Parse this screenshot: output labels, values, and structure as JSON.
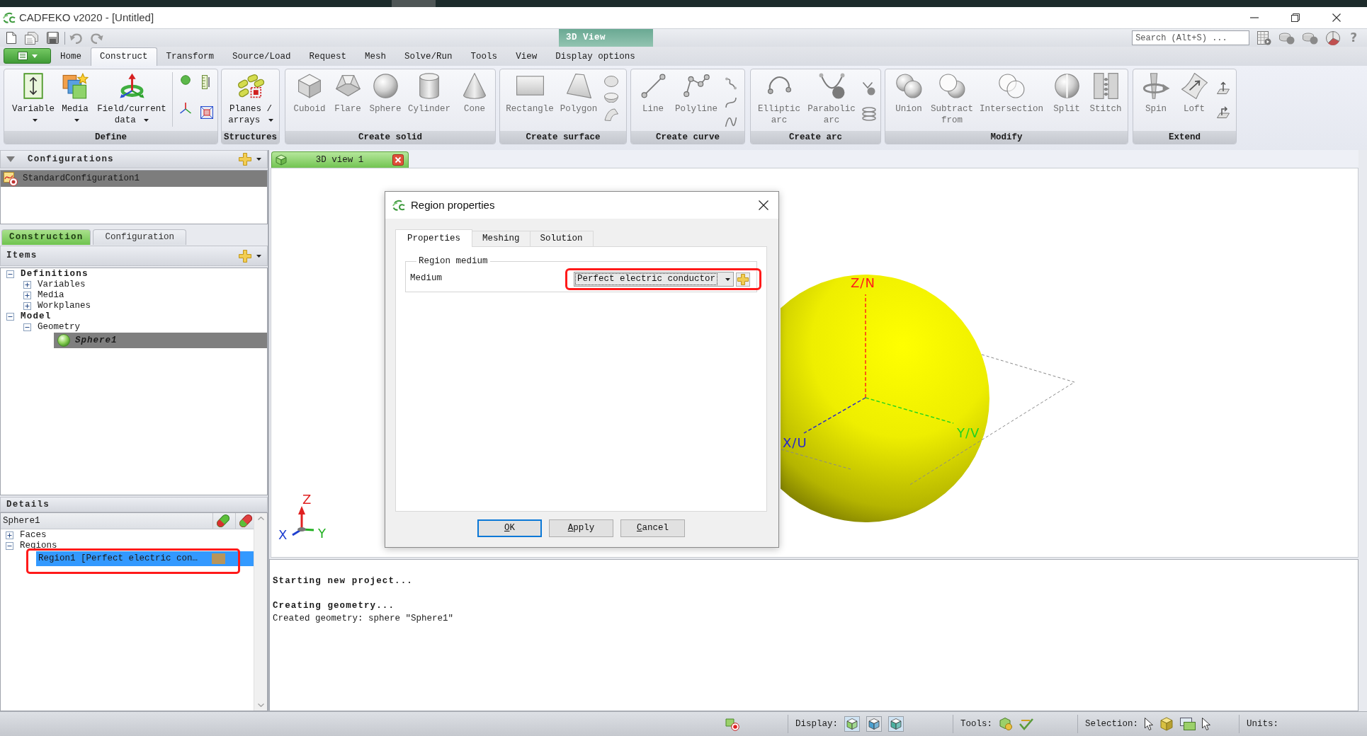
{
  "window": {
    "title": "CADFEKO v2020 - [Untitled]"
  },
  "quick_access": {
    "context_tab": "3D View",
    "search": {
      "placeholder": "Search (Alt+S) ..."
    },
    "help": "?"
  },
  "ribbon": {
    "tabs": [
      {
        "label": "Home",
        "selected": false
      },
      {
        "label": "Construct",
        "selected": true
      },
      {
        "label": "Transform",
        "selected": false
      },
      {
        "label": "Source/Load",
        "selected": false
      },
      {
        "label": "Request",
        "selected": false
      },
      {
        "label": "Mesh",
        "selected": false
      },
      {
        "label": "Solve/Run",
        "selected": false
      },
      {
        "label": "Tools",
        "selected": false
      },
      {
        "label": "View",
        "selected": false
      },
      {
        "label": "Display options",
        "selected": false
      }
    ],
    "groups": [
      {
        "title": "Define",
        "buttons": [
          {
            "label": "Variable",
            "menu": true,
            "disabled": false
          },
          {
            "label": "Media",
            "menu": true,
            "disabled": false
          },
          {
            "label": "Field/current data",
            "menu": true,
            "disabled": false
          }
        ]
      },
      {
        "title": "Structures",
        "buttons": [
          {
            "label": "Planes / arrays",
            "menu": true,
            "disabled": false
          }
        ]
      },
      {
        "title": "Create solid",
        "buttons": [
          {
            "label": "Cuboid",
            "menu": false,
            "disabled": true
          },
          {
            "label": "Flare",
            "menu": false,
            "disabled": true
          },
          {
            "label": "Sphere",
            "menu": false,
            "disabled": true
          },
          {
            "label": "Cylinder",
            "menu": false,
            "disabled": true
          },
          {
            "label": "Cone",
            "menu": false,
            "disabled": true
          }
        ]
      },
      {
        "title": "Create surface",
        "buttons": [
          {
            "label": "Rectangle",
            "menu": false,
            "disabled": true
          },
          {
            "label": "Polygon",
            "menu": false,
            "disabled": true
          }
        ]
      },
      {
        "title": "Create curve",
        "buttons": [
          {
            "label": "Line",
            "menu": false,
            "disabled": true
          },
          {
            "label": "Polyline",
            "menu": false,
            "disabled": true
          }
        ]
      },
      {
        "title": "Create arc",
        "buttons": [
          {
            "label": "Elliptic arc",
            "menu": false,
            "disabled": true
          },
          {
            "label": "Parabolic arc",
            "menu": false,
            "disabled": true
          }
        ]
      },
      {
        "title": "Modify",
        "buttons": [
          {
            "label": "Union",
            "menu": false,
            "disabled": true
          },
          {
            "label": "Subtract from",
            "menu": false,
            "disabled": true
          },
          {
            "label": "Intersection",
            "menu": false,
            "disabled": true
          },
          {
            "label": "Split",
            "menu": false,
            "disabled": true
          },
          {
            "label": "Stitch",
            "menu": false,
            "disabled": true
          }
        ]
      },
      {
        "title": "Extend",
        "buttons": [
          {
            "label": "Spin",
            "menu": false,
            "disabled": true
          },
          {
            "label": "Loft",
            "menu": false,
            "disabled": true
          }
        ]
      }
    ]
  },
  "configurations": {
    "title": "Configurations",
    "items": [
      {
        "label": "StandardConfiguration1",
        "selected": true
      }
    ]
  },
  "panel_tabs": [
    {
      "label": "Construction",
      "selected": true
    },
    {
      "label": "Configuration",
      "selected": false
    }
  ],
  "items": {
    "title": "Items",
    "tree": [
      {
        "label": "Definitions",
        "expanded": true,
        "selected": false,
        "children": [
          {
            "label": "Variables",
            "expanded": false,
            "selected": false
          },
          {
            "label": "Media",
            "expanded": false,
            "selected": false
          },
          {
            "label": "Workplanes",
            "expanded": false,
            "selected": false
          }
        ]
      },
      {
        "label": "Model",
        "expanded": true,
        "selected": false,
        "children": [
          {
            "label": "Geometry",
            "expanded": true,
            "selected": false,
            "children": [
              {
                "label": "Sphere1",
                "selected": true
              }
            ]
          }
        ]
      }
    ]
  },
  "details": {
    "title": "Details",
    "object": "Sphere1",
    "tree": [
      {
        "label": "Faces",
        "expanded": false,
        "selected": false,
        "highlighted": false
      },
      {
        "label": "Regions",
        "expanded": true,
        "selected": false,
        "highlighted": false,
        "children": [
          {
            "label": "Region1 [Perfect electric con…",
            "selected": true,
            "highlighted": true,
            "color": "#b8955a"
          }
        ]
      }
    ]
  },
  "view_tabs": [
    {
      "label": "3D view 1",
      "selected": true
    }
  ],
  "viewport": {
    "axis_labels": [
      {
        "kind": "z",
        "text": "Z/N"
      },
      {
        "kind": "x",
        "text": "X/U"
      },
      {
        "kind": "y",
        "text": "Y/V"
      }
    ],
    "triad_labels": [
      {
        "kind": "z",
        "text": "Z"
      },
      {
        "kind": "x",
        "text": "X"
      },
      {
        "kind": "y",
        "text": "Y"
      }
    ]
  },
  "dialog": {
    "title": "Region properties",
    "tabs": [
      {
        "label": "Properties",
        "selected": true
      },
      {
        "label": "Meshing",
        "selected": false
      },
      {
        "label": "Solution",
        "selected": false
      }
    ],
    "group_title": "Region medium",
    "field": {
      "label": "Medium",
      "value": "Perfect electric conductor",
      "highlighted": true
    },
    "buttons": [
      {
        "label": "OK",
        "default": true
      },
      {
        "label": "Apply",
        "default": false
      },
      {
        "label": "Cancel",
        "default": false
      }
    ]
  },
  "console": [
    {
      "kind": "heading",
      "text": "Starting new project..."
    },
    {
      "kind": "heading",
      "text": "Creating geometry..."
    },
    {
      "kind": "message",
      "text": "Created geometry: sphere \"Sphere1\""
    }
  ],
  "status_bar": {
    "sections": [
      {
        "label": "Display:"
      },
      {
        "label": "Tools:"
      },
      {
        "label": "Selection:"
      },
      {
        "label": "Units:"
      }
    ]
  }
}
